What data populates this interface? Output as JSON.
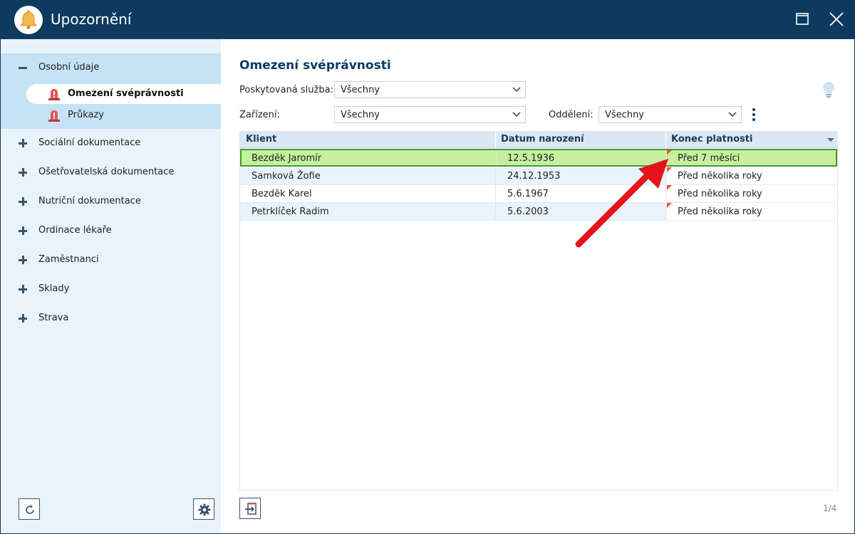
{
  "window": {
    "title": "Upozornění"
  },
  "sidebar": {
    "groups": [
      {
        "label": "Osobní údaje",
        "expanded": true,
        "items": [
          {
            "label": "Omezení svéprávnosti",
            "active": true
          },
          {
            "label": "Průkazy",
            "active": false
          }
        ]
      },
      {
        "label": "Sociální dokumentace",
        "expanded": false
      },
      {
        "label": "Ošetřovatelská dokumentace",
        "expanded": false
      },
      {
        "label": "Nutriční dokumentace",
        "expanded": false
      },
      {
        "label": "Ordinace lékaře",
        "expanded": false
      },
      {
        "label": "Zaměstnanci",
        "expanded": false
      },
      {
        "label": "Sklady",
        "expanded": false
      },
      {
        "label": "Strava",
        "expanded": false
      }
    ]
  },
  "main": {
    "title": "Omezení svéprávnosti",
    "filters": {
      "service_label": "Poskytovaná služba:",
      "service_value": "Všechny",
      "facility_label": "Zařízení:",
      "facility_value": "Všechny",
      "department_label": "Oddělení:",
      "department_value": "Všechny"
    },
    "grid": {
      "columns": [
        "Klient",
        "Datum narození",
        "Konec platnosti"
      ],
      "rows": [
        {
          "klient": "Bezděk Jaromír",
          "datum": "12.5.1936",
          "konec": "Před 7 měsíci",
          "selected": true
        },
        {
          "klient": "Samková Žofie",
          "datum": "24.12.1953",
          "konec": "Před několika roky",
          "selected": false
        },
        {
          "klient": "Bezděk Karel",
          "datum": "5.6.1967",
          "konec": "Před několika roky",
          "selected": false
        },
        {
          "klient": "Petrklíček Radim",
          "datum": "5.6.2003",
          "konec": "Před několika roky",
          "selected": false
        }
      ]
    },
    "pager": "1/4"
  },
  "colors": {
    "titlebar": "#0f3a60",
    "sidebar_bg": "#e8f3fb",
    "sidebar_active_group": "#c6e3f5",
    "selected_row": "#c6ef9e",
    "selected_border": "#3f9a3a",
    "accent_flag": "#f05a28",
    "arrow": "#e3151a"
  },
  "icons": {
    "app": "bell-icon",
    "maximize": "maximize-icon",
    "close": "close-icon",
    "alarm": "alarm-light-icon",
    "refresh": "refresh-icon",
    "settings": "gear-icon",
    "hint": "lightbulb-icon",
    "more": "kebab-menu-icon",
    "export": "export-icon"
  }
}
